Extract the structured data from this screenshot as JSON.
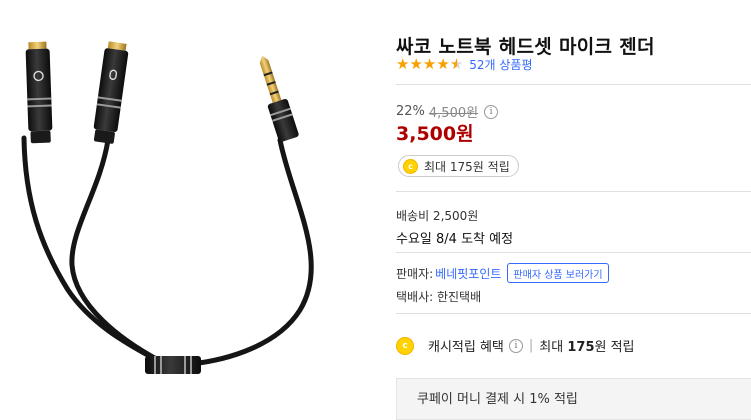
{
  "product": {
    "title": "싸코 노트북 헤드셋 마이크 젠더",
    "rating": 4.5,
    "review_count_text": "52개 상품평",
    "discount_rate": "22%",
    "original_price": "4,500원",
    "info_glyph": "i",
    "sale_price": "3,500원",
    "cash_badge_text": "최대 175원 적립",
    "coin_glyph": "c"
  },
  "shipping": {
    "fee_text": "배송비 2,500원",
    "arrival_text": "수요일 8/4 도착 예정"
  },
  "seller": {
    "label": "판매자:",
    "name": "베네핏포인트",
    "view_products_button": "판매자 상품 보러가기",
    "courier_text": "택배사: 한진택배"
  },
  "cash_benefit": {
    "label": "캐시적립 혜택",
    "separator": "|",
    "amount_prefix": "최대",
    "amount": "175",
    "amount_suffix": "원 적립"
  },
  "coupon": {
    "text": "쿠페이 머니 결제 시 1% 적립"
  },
  "colors": {
    "price_red": "#ae0000",
    "link_blue": "#346aff",
    "star_gold": "#f8a000",
    "coin_yellow": "#ffd200"
  }
}
